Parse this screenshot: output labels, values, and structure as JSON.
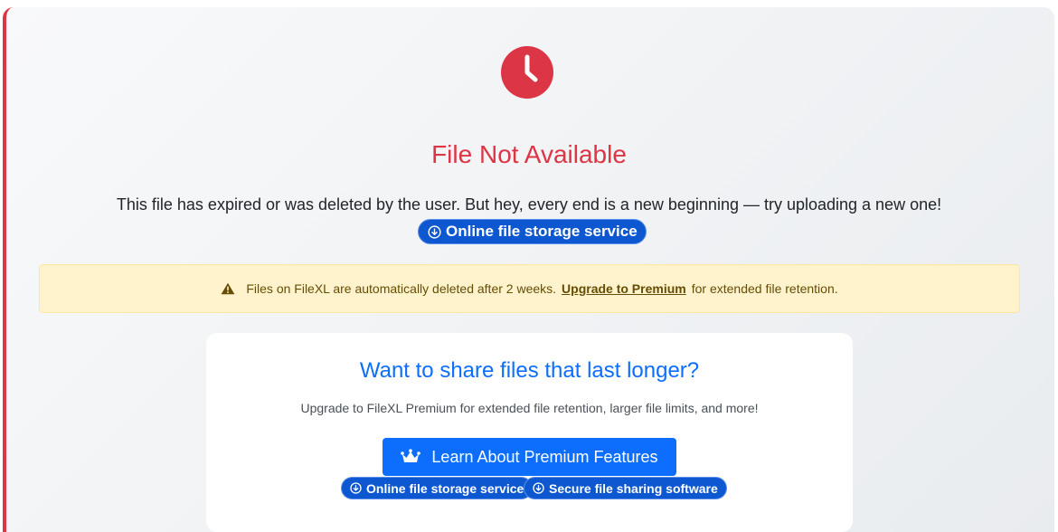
{
  "error": {
    "icon": "clock-icon",
    "title": "File Not Available",
    "description": "This file has expired or was deleted by the user. But hey, every end is a new beginning — try uploading a new one!",
    "link_label": "Online file storage service"
  },
  "alert": {
    "icon": "warning-icon",
    "text_before": "Files on FileXL are automatically deleted after 2 weeks.",
    "link_label": "Upgrade to Premium",
    "text_after": "for extended file retention."
  },
  "promo": {
    "title": "Want to share files that last longer?",
    "description": "Upgrade to FileXL Premium for extended file retention, larger file limits, and more!",
    "button_icon": "crown-icon",
    "button_label": "Learn About Premium Features",
    "links": [
      {
        "label": "Online file storage service"
      },
      {
        "label": "Secure file sharing software"
      }
    ]
  },
  "colors": {
    "danger": "#dc3545",
    "primary": "#0d6efd",
    "pill": "#0d57d1",
    "alert_bg": "#fff3cd",
    "alert_text": "#664d03"
  }
}
